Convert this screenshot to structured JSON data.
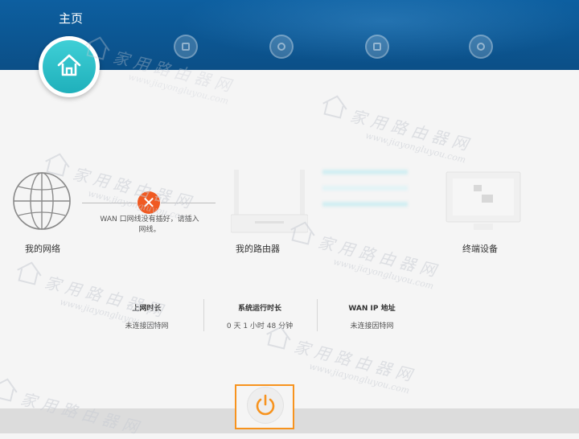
{
  "header": {
    "home_title": "主页",
    "nav_items": [
      {
        "label": "",
        "icon": "internet-icon"
      },
      {
        "label": "",
        "icon": "wifi-icon"
      },
      {
        "label": "",
        "icon": "devices-icon"
      },
      {
        "label": "",
        "icon": "more-icon"
      }
    ]
  },
  "topology": {
    "my_network": "我的网络",
    "error_text": "WAN 口网线没有插好，请插入网线。",
    "my_router": "我的路由器",
    "terminal_devices": "终端设备"
  },
  "stats": [
    {
      "title": "上网时长",
      "value": "未连接因特网"
    },
    {
      "title": "系统运行时长",
      "value": "0 天 1 小时 48 分钟"
    },
    {
      "title": "WAN IP 地址",
      "value": "未连接因特网"
    }
  ],
  "watermark": {
    "cn": "家用路由器网",
    "en": "www.jiayongluyou.com"
  },
  "colors": {
    "header_blue": "#0d5fa0",
    "home_teal": "#1fb0bb",
    "error_orange": "#f05a22",
    "power_outline": "#f7931e"
  }
}
